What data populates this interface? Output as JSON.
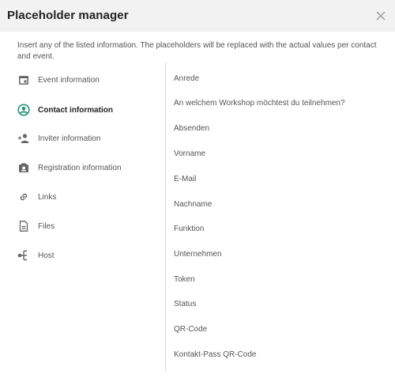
{
  "dialog": {
    "title": "Placeholder manager",
    "description": "Insert any of the listed information. The placeholders will be replaced with the actual values per contact and event."
  },
  "categories": [
    {
      "label": "Event information",
      "icon": "calendar-icon",
      "active": false
    },
    {
      "label": "Contact information",
      "icon": "account-circle-icon",
      "active": true
    },
    {
      "label": "Inviter information",
      "icon": "person-add-icon",
      "active": false
    },
    {
      "label": "Registration information",
      "icon": "registration-card-icon",
      "active": false
    },
    {
      "label": "Links",
      "icon": "link-icon",
      "active": false
    },
    {
      "label": "Files",
      "icon": "file-icon",
      "active": false
    },
    {
      "label": "Host",
      "icon": "host-tree-icon",
      "active": false
    }
  ],
  "placeholders": [
    "Anrede",
    "An welchem Workshop möchtest du teilnehmen?",
    "Absenden",
    "Vorname",
    "E-Mail",
    "Nachname",
    "Funktion",
    "Unternehmen",
    "Token",
    "Status",
    "QR-Code",
    "Kontakt-Pass QR-Code"
  ],
  "colors": {
    "active_accent": "#1e8f73",
    "icon_gray": "#666666",
    "header_bg": "#f2f2f2"
  }
}
